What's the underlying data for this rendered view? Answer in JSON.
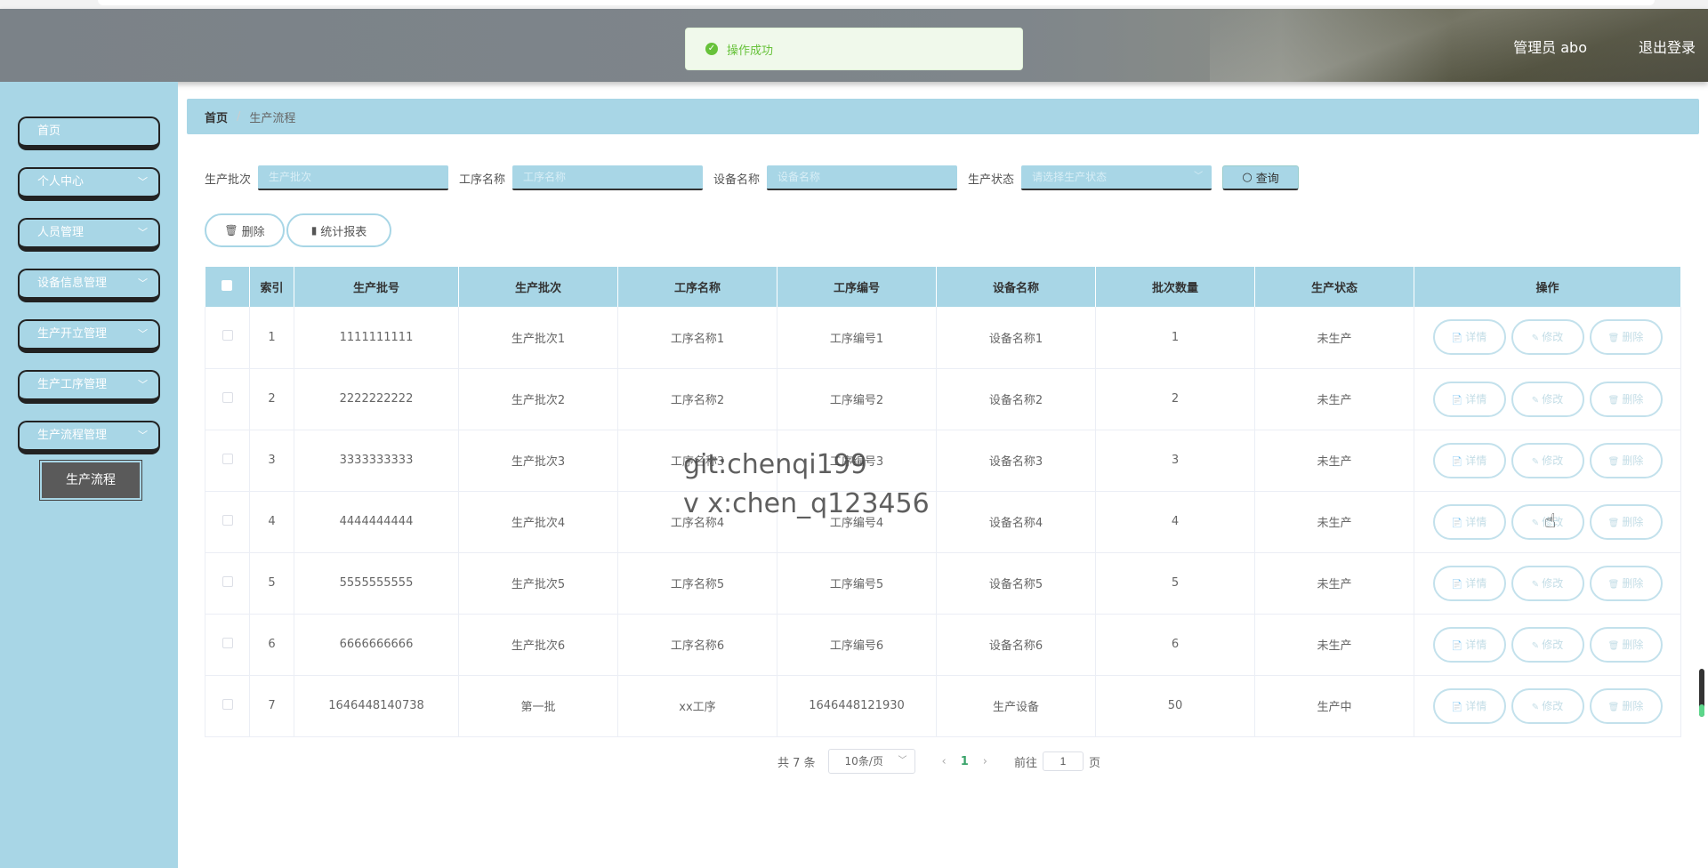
{
  "header": {
    "user_label": "管理员 abo",
    "logout_label": "退出登录"
  },
  "toast": {
    "message": "操作成功"
  },
  "sidebar": {
    "items": [
      {
        "label": "首页",
        "has_chevron": false
      },
      {
        "label": "个人中心",
        "has_chevron": true
      },
      {
        "label": "人员管理",
        "has_chevron": true
      },
      {
        "label": "设备信息管理",
        "has_chevron": true
      },
      {
        "label": "生产开立管理",
        "has_chevron": true
      },
      {
        "label": "生产工序管理",
        "has_chevron": true
      },
      {
        "label": "生产流程管理",
        "has_chevron": true
      }
    ],
    "active_sub": "生产流程"
  },
  "breadcrumb": {
    "home": "首页",
    "separator": "/",
    "current": "生产流程"
  },
  "search": {
    "batch_label": "生产批次",
    "batch_placeholder": "生产批次",
    "process_label": "工序名称",
    "process_placeholder": "工序名称",
    "device_label": "设备名称",
    "device_placeholder": "设备名称",
    "status_label": "生产状态",
    "status_placeholder": "请选择生产状态",
    "query_label": "查询"
  },
  "toolbar": {
    "delete_label": "删除",
    "report_label": "统计报表"
  },
  "table": {
    "headers": [
      "索引",
      "生产批号",
      "生产批次",
      "工序名称",
      "工序编号",
      "设备名称",
      "批次数量",
      "生产状态",
      "操作"
    ],
    "action_labels": {
      "detail": "详情",
      "edit": "修改",
      "delete": "删除"
    },
    "rows": [
      {
        "index": "1",
        "batch_no": "1111111111",
        "batch": "生产批次1",
        "process_name": "工序名称1",
        "process_no": "工序编号1",
        "device": "设备名称1",
        "qty": "1",
        "status": "未生产"
      },
      {
        "index": "2",
        "batch_no": "2222222222",
        "batch": "生产批次2",
        "process_name": "工序名称2",
        "process_no": "工序编号2",
        "device": "设备名称2",
        "qty": "2",
        "status": "未生产"
      },
      {
        "index": "3",
        "batch_no": "3333333333",
        "batch": "生产批次3",
        "process_name": "工序名称3",
        "process_no": "工序编号3",
        "device": "设备名称3",
        "qty": "3",
        "status": "未生产"
      },
      {
        "index": "4",
        "batch_no": "4444444444",
        "batch": "生产批次4",
        "process_name": "工序名称4",
        "process_no": "工序编号4",
        "device": "设备名称4",
        "qty": "4",
        "status": "未生产"
      },
      {
        "index": "5",
        "batch_no": "5555555555",
        "batch": "生产批次5",
        "process_name": "工序名称5",
        "process_no": "工序编号5",
        "device": "设备名称5",
        "qty": "5",
        "status": "未生产"
      },
      {
        "index": "6",
        "batch_no": "6666666666",
        "batch": "生产批次6",
        "process_name": "工序名称6",
        "process_no": "工序编号6",
        "device": "设备名称6",
        "qty": "6",
        "status": "未生产"
      },
      {
        "index": "7",
        "batch_no": "1646448140738",
        "batch": "第一批",
        "process_name": "xx工序",
        "process_no": "1646448121930",
        "device": "生产设备",
        "qty": "50",
        "status": "生产中"
      }
    ]
  },
  "pagination": {
    "total_label": "共 7 条",
    "page_size": "10条/页",
    "current_page": "1",
    "goto_prefix": "前往",
    "goto_value": "1",
    "goto_suffix": "页"
  },
  "watermark": {
    "line1": "git:chenqi199",
    "line2": "v x:chen_q123456"
  },
  "colors": {
    "accent": "#a8d6e6",
    "success": "#67c23a",
    "header_bg": "#7b8288",
    "sub_active_bg": "#5a5a5a"
  }
}
